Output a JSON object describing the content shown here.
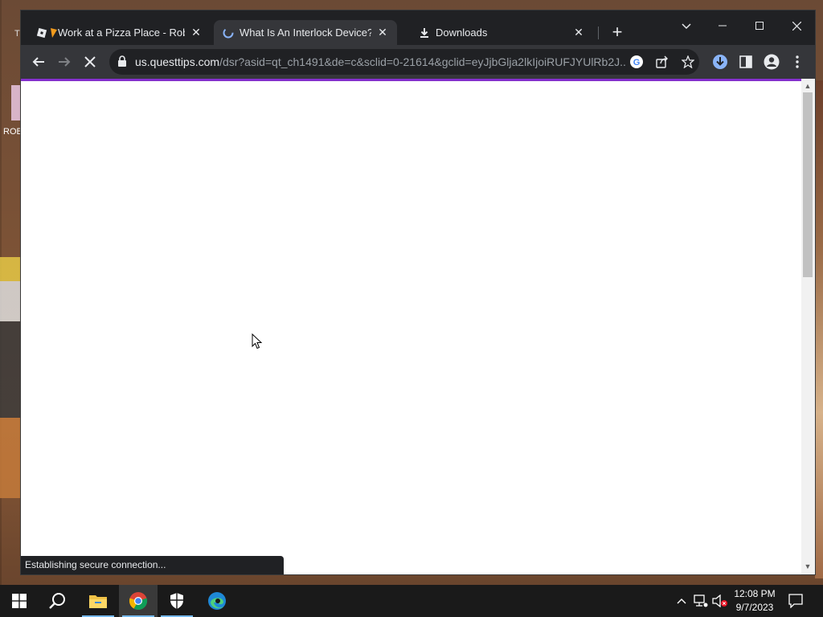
{
  "desktop": {
    "top_left_glyph": "T",
    "left_label": "ROB"
  },
  "tabs": [
    {
      "title": "Work at a Pizza Place - Roblox",
      "favicon": "roblox-icon",
      "active": false
    },
    {
      "title": "What Is An Interlock Device? - U",
      "favicon": "loading-spinner-icon",
      "active": true
    },
    {
      "title": "Downloads",
      "favicon": "download-icon",
      "active": false
    }
  ],
  "toolbar": {
    "url_host": "us.questtips.com",
    "url_path": "/dsr?asid=qt_ch1491&de=c&sclid=0-21614&gclid=eyJjbGlja2lkIjoiRUFJYUlRb2J..."
  },
  "status_text": "Establishing secure connection...",
  "taskbar": {
    "clock_time": "12:08 PM",
    "clock_date": "9/7/2023"
  },
  "colors": {
    "progress_bar": "#8430ce",
    "tab_strip": "#202124",
    "toolbar": "#35363a"
  }
}
